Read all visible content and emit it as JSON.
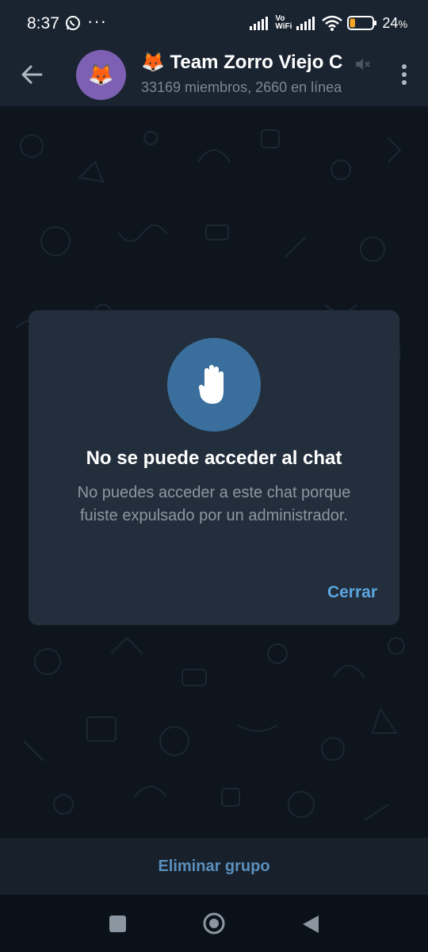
{
  "status_bar": {
    "time": "8:37",
    "more_dots": "···",
    "vo": "Vo",
    "wifi_label": "WiFi",
    "battery_percent": "24",
    "battery_suffix": "%",
    "battery_level": 0.24
  },
  "header": {
    "title": "🦊 Team Zorro Viejo C",
    "subtitle": "33169 miembros, 2660 en línea",
    "avatar_emoji": "🦊"
  },
  "dialog": {
    "title": "No se puede acceder al chat",
    "message": "No puedes acceder a este chat porque fuiste expulsado por un administrador.",
    "close_label": "Cerrar"
  },
  "bottom_action": {
    "label": "Eliminar grupo"
  },
  "colors": {
    "accent": "#5ca6e0",
    "icon_circle": "#3a6f9d",
    "avatar_bg": "#7d5fb3",
    "battery_orange": "#f5a623"
  }
}
